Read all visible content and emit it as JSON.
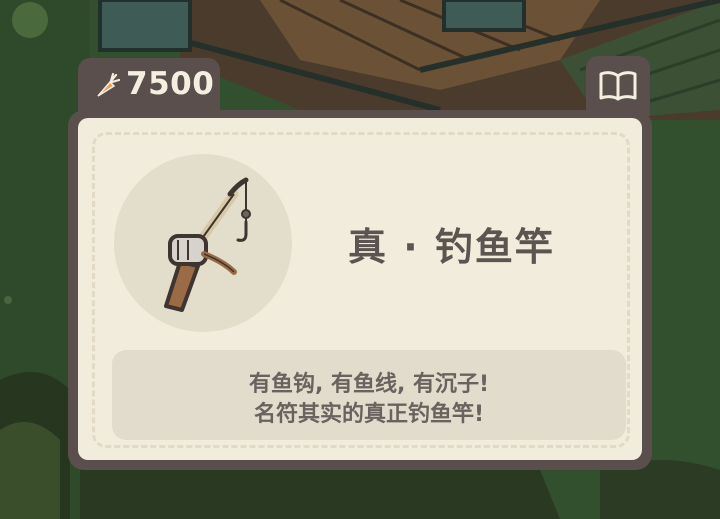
{
  "currency": {
    "icon": "carrot-icon",
    "amount": "7500"
  },
  "header": {
    "book_icon": "book-icon"
  },
  "item": {
    "icon": "fishing-rod-icon",
    "name": "真 · 钓鱼竿",
    "description_line1": "有鱼钩, 有鱼线, 有沉子!",
    "description_line2": "名符其实的真正钓鱼竿!"
  },
  "colors": {
    "panel_frame": "#5a4f4c",
    "panel_fill": "#f2ecdc",
    "text_dark": "#5b5450",
    "grass": "#2f4a2c"
  }
}
